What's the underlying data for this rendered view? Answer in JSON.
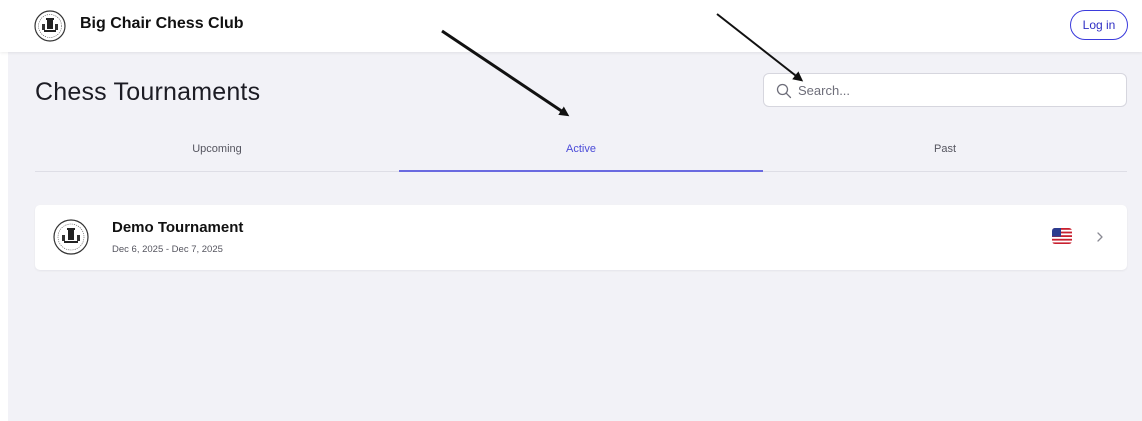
{
  "header": {
    "club_name": "Big Chair Chess Club",
    "login_label": "Log in",
    "logo_icon": "chess-club-logo-icon"
  },
  "main": {
    "title": "Chess Tournaments",
    "search": {
      "placeholder": "Search...",
      "value": ""
    },
    "tabs": [
      {
        "label": "Upcoming",
        "active": false
      },
      {
        "label": "Active",
        "active": true
      },
      {
        "label": "Past",
        "active": false
      }
    ],
    "tournaments": [
      {
        "name": "Demo Tournament",
        "dates": "Dec 6, 2025 - Dec 7, 2025",
        "flag_icon": "us-flag-icon"
      }
    ]
  },
  "colors": {
    "accent": "#4b4bd8",
    "background": "#f2f2f7",
    "card": "#ffffff"
  }
}
